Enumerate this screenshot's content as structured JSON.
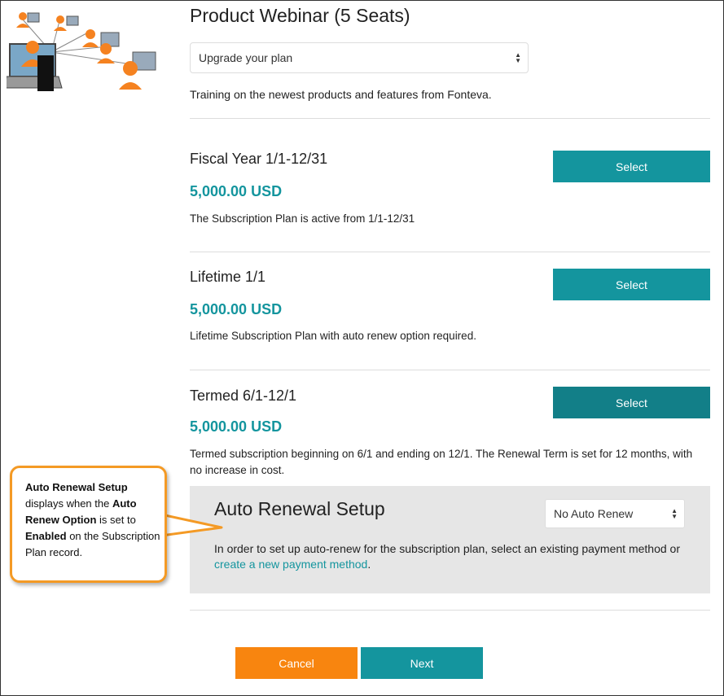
{
  "page": {
    "title": "Product Webinar (5 Seats)",
    "plan_select_value": "Upgrade your plan",
    "description": "Training on the newest products and features from Fonteva."
  },
  "plans": [
    {
      "name": "Fiscal Year 1/1-12/31",
      "price": "5,000.00 USD",
      "description": "The Subscription Plan is active from 1/1-12/31",
      "button": "Select"
    },
    {
      "name": "Lifetime 1/1",
      "price": "5,000.00 USD",
      "description": "Lifetime Subscription Plan with auto renew option required.",
      "button": "Select"
    },
    {
      "name": "Termed 6/1-12/1",
      "price": "5,000.00 USD",
      "description": "Termed subscription beginning on 6/1 and ending on 12/1. The Renewal Term is set for 12 months, with no increase in cost.",
      "button": "Select"
    }
  ],
  "auto_renewal": {
    "title": "Auto Renewal Setup",
    "select_value": "No Auto Renew",
    "text_before": "In order to set up auto-renew for the subscription plan, select an existing payment method or ",
    "link": "create a new payment method",
    "text_after": "."
  },
  "actions": {
    "cancel": "Cancel",
    "next": "Next"
  },
  "callout": {
    "bold1": "Auto Renewal Setup",
    "text1": " displays when the ",
    "bold2": "Auto Renew Option",
    "text2": " is set to ",
    "bold3": "Enabled",
    "text3": " on the Subscription Plan record."
  },
  "colors": {
    "accent": "#14959e",
    "cancel": "#f8850f",
    "callout_border": "#f49a25"
  }
}
